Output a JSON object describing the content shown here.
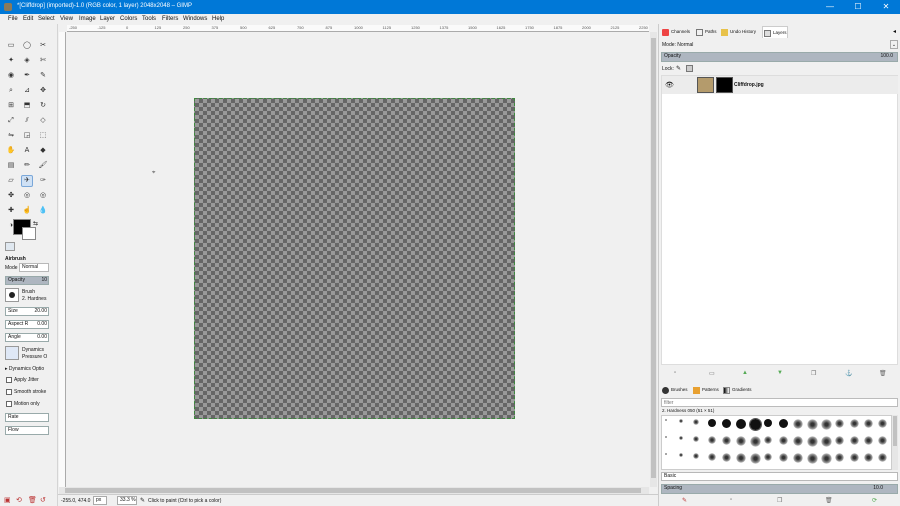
{
  "window": {
    "title": "*[Cliffdrop] (imported)-1.0 (RGB color, 1 layer) 2048x2048 – GIMP",
    "minimize": "—",
    "maximize": "☐",
    "close": "✕"
  },
  "menu": [
    "File",
    "Edit",
    "Select",
    "View",
    "Image",
    "Layer",
    "Colors",
    "Tools",
    "Filters",
    "Windows",
    "Help"
  ],
  "ruler": [
    "-250",
    "-125",
    "0",
    "125",
    "250",
    "375",
    "500",
    "625",
    "750",
    "875",
    "1000",
    "1125",
    "1250",
    "1375",
    "1500",
    "1625",
    "1750",
    "1875",
    "2000",
    "2125",
    "2250"
  ],
  "tool_options": {
    "title": "Airbrush",
    "mode_label": "Mode",
    "mode_value": "Normal",
    "opacity_label": "Opacity",
    "opacity_value": "10",
    "brush_label": "Brush",
    "brush_value": "2. Hardnes",
    "size_label": "Size",
    "size_value": "20.00",
    "aspect_label": "Aspect R",
    "aspect_value": "0.00",
    "angle_label": "Angle",
    "angle_value": "0.00",
    "dynamics_label": "Dynamics",
    "dynamics_value": "Pressure O",
    "dynamics_options": "Dynamics Optio",
    "apply_jitter": "Apply Jitter",
    "smooth_stroke": "Smooth stroke",
    "motion_only": "Motion only",
    "rate_label": "Rate",
    "flow_label": "Flow"
  },
  "status": {
    "coords": "-255.0, 474.0",
    "unit": "px",
    "zoom": "33.3 %",
    "message": "Click to paint (Ctrl to pick a color)"
  },
  "dock": {
    "tabs": [
      "Channels",
      "Paths",
      "Undo History",
      "Layers"
    ],
    "mode_label": "Mode",
    "mode_value": "Normal",
    "opacity_label": "Opacity",
    "opacity_value": "100.0",
    "lock_label": "Lock:",
    "layer_name": "Cliffdrop.jpg"
  },
  "brushes": {
    "tabs": [
      "Brushes",
      "Patterns",
      "Gradients"
    ],
    "filter_placeholder": "filter",
    "current": "2. Hardness 050 (51 × 51)",
    "preset": "Basic",
    "spacing_label": "Spacing",
    "spacing_value": "10.0"
  },
  "colors": {
    "accent": "#0078d7",
    "layer_thumb": "#b49b6c",
    "selection": "#3d8a3d"
  }
}
